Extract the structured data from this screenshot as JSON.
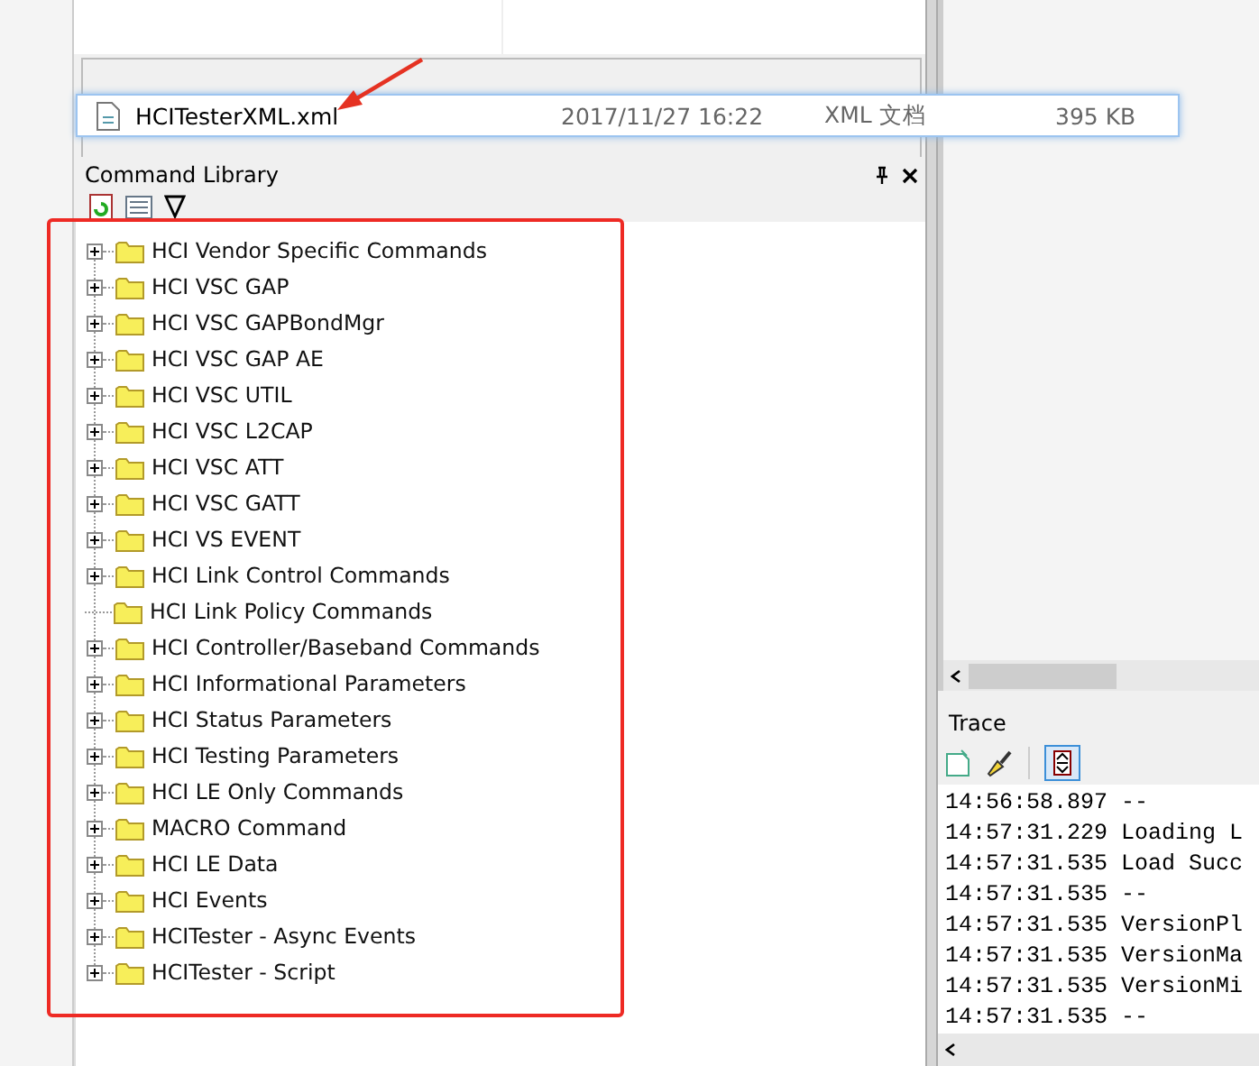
{
  "file_row": {
    "name": "HCITesterXML.xml",
    "date": "2017/11/27 16:22",
    "type": "XML 文档",
    "size": "395 KB"
  },
  "command_library": {
    "title": "Command Library",
    "tree": [
      {
        "label": "HCI Vendor Specific Commands",
        "expandable": true
      },
      {
        "label": "HCI VSC GAP",
        "expandable": true
      },
      {
        "label": "HCI VSC GAPBondMgr",
        "expandable": true
      },
      {
        "label": "HCI VSC GAP AE",
        "expandable": true
      },
      {
        "label": "HCI VSC UTIL",
        "expandable": true
      },
      {
        "label": "HCI VSC L2CAP",
        "expandable": true
      },
      {
        "label": "HCI VSC ATT",
        "expandable": true
      },
      {
        "label": "HCI VSC GATT",
        "expandable": true
      },
      {
        "label": "HCI VS EVENT",
        "expandable": true
      },
      {
        "label": "HCI Link Control Commands",
        "expandable": true
      },
      {
        "label": "HCI Link Policy Commands",
        "expandable": false
      },
      {
        "label": "HCI Controller/Baseband Commands",
        "expandable": true
      },
      {
        "label": "HCI Informational Parameters",
        "expandable": true
      },
      {
        "label": "HCI Status Parameters",
        "expandable": true
      },
      {
        "label": "HCI Testing Parameters",
        "expandable": true
      },
      {
        "label": "HCI LE Only Commands",
        "expandable": true
      },
      {
        "label": "MACRO Command",
        "expandable": true
      },
      {
        "label": "HCI LE Data",
        "expandable": true
      },
      {
        "label": "HCI Events",
        "expandable": true
      },
      {
        "label": "HCITester - Async Events",
        "expandable": true
      },
      {
        "label": "HCITester - Script",
        "expandable": true
      }
    ]
  },
  "trace": {
    "title": "Trace",
    "lines": [
      "14:56:58.897 --",
      "14:57:31.229 Loading L",
      "14:57:31.535 Load Succ",
      "14:57:31.535 --",
      "14:57:31.535 VersionPl",
      "14:57:31.535 VersionMa",
      "14:57:31.535 VersionMi",
      "14:57:31.535 --"
    ]
  }
}
